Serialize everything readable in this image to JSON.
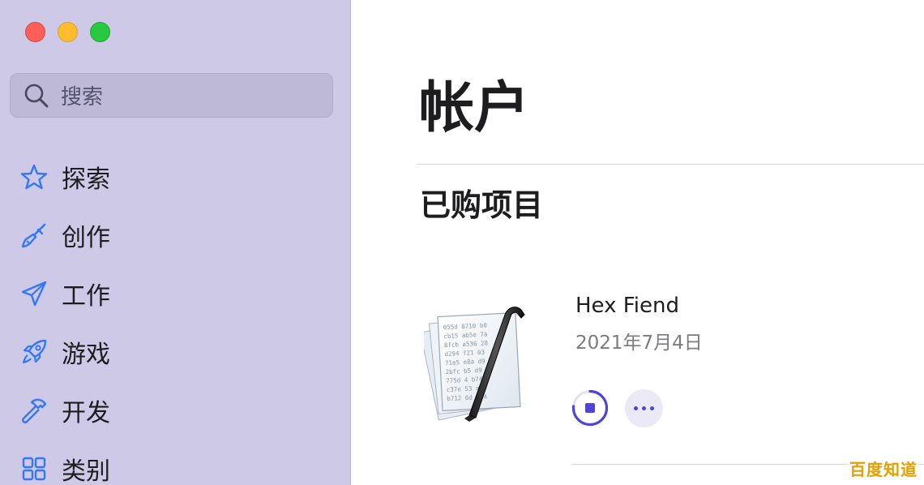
{
  "sidebar": {
    "search": {
      "placeholder": "搜索",
      "icon": "magnifying-glass-icon"
    },
    "items": [
      {
        "label": "探索",
        "icon": "star-icon"
      },
      {
        "label": "创作",
        "icon": "paintbrush-icon"
      },
      {
        "label": "工作",
        "icon": "paper-plane-icon"
      },
      {
        "label": "游戏",
        "icon": "rocket-icon"
      },
      {
        "label": "开发",
        "icon": "hammer-icon"
      },
      {
        "label": "类别",
        "icon": "grid-icon"
      }
    ],
    "accent_color": "#3478f6",
    "background": "#cdc9e6"
  },
  "main": {
    "title": "帐户",
    "section_title": "已购项目",
    "purchases": [
      {
        "name": "Hex Fiend",
        "date": "2021年7月4日",
        "icon": "hex-fiend-app-icon",
        "status": "downloading",
        "actions": [
          "stop-download",
          "more-options"
        ]
      }
    ],
    "button_accent": "#4e44d6"
  },
  "watermark": "百度知道"
}
